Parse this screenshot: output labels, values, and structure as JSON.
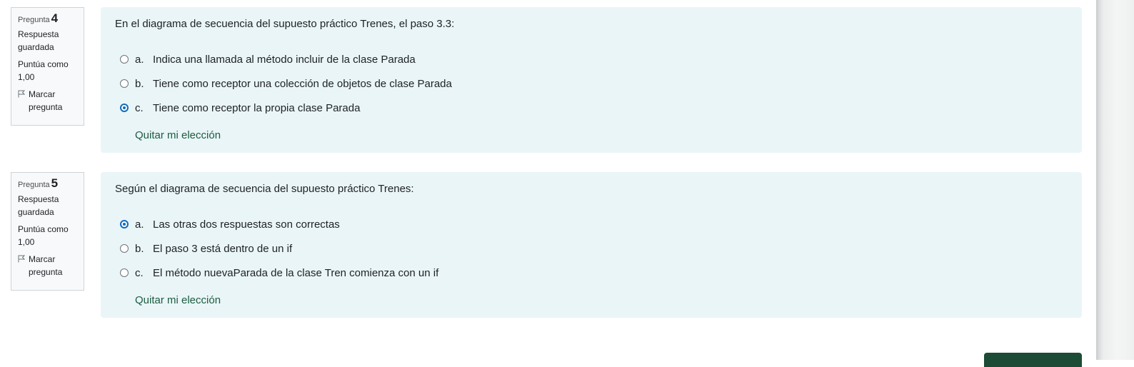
{
  "questions": [
    {
      "label_word": "Pregunta",
      "number": "4",
      "state": "Respuesta guardada",
      "grade": "Puntúa como 1,00",
      "flag_label": "Marcar pregunta",
      "text": "En el diagrama de secuencia del supuesto práctico Trenes, el paso 3.3:",
      "answers": [
        {
          "letter": "a.",
          "text": "Indica una llamada al método incluir de la clase Parada",
          "checked": false
        },
        {
          "letter": "b.",
          "text": "Tiene como receptor una colección de objetos de clase Parada",
          "checked": false
        },
        {
          "letter": "c.",
          "text": "Tiene como receptor la propia clase Parada",
          "checked": true
        }
      ],
      "clear_label": "Quitar mi elección"
    },
    {
      "label_word": "Pregunta",
      "number": "5",
      "state": "Respuesta guardada",
      "grade": "Puntúa como 1,00",
      "flag_label": "Marcar pregunta",
      "text": "Según el diagrama de secuencia del supuesto práctico Trenes:",
      "answers": [
        {
          "letter": "a.",
          "text": "Las otras dos respuestas son correctas",
          "checked": true
        },
        {
          "letter": "b.",
          "text": "El paso 3 está dentro de un if",
          "checked": false
        },
        {
          "letter": "c.",
          "text": "El método nuevaParada de la clase Tren comienza con un if",
          "checked": false
        }
      ],
      "clear_label": "Quitar mi elección"
    }
  ],
  "colors": {
    "content_bg": "#eaf5f8",
    "accent": "#0f6cbf",
    "link": "#1c5c3e",
    "primary_button": "#1c4c35"
  },
  "icons": {
    "flag": "flag-outline-icon"
  }
}
